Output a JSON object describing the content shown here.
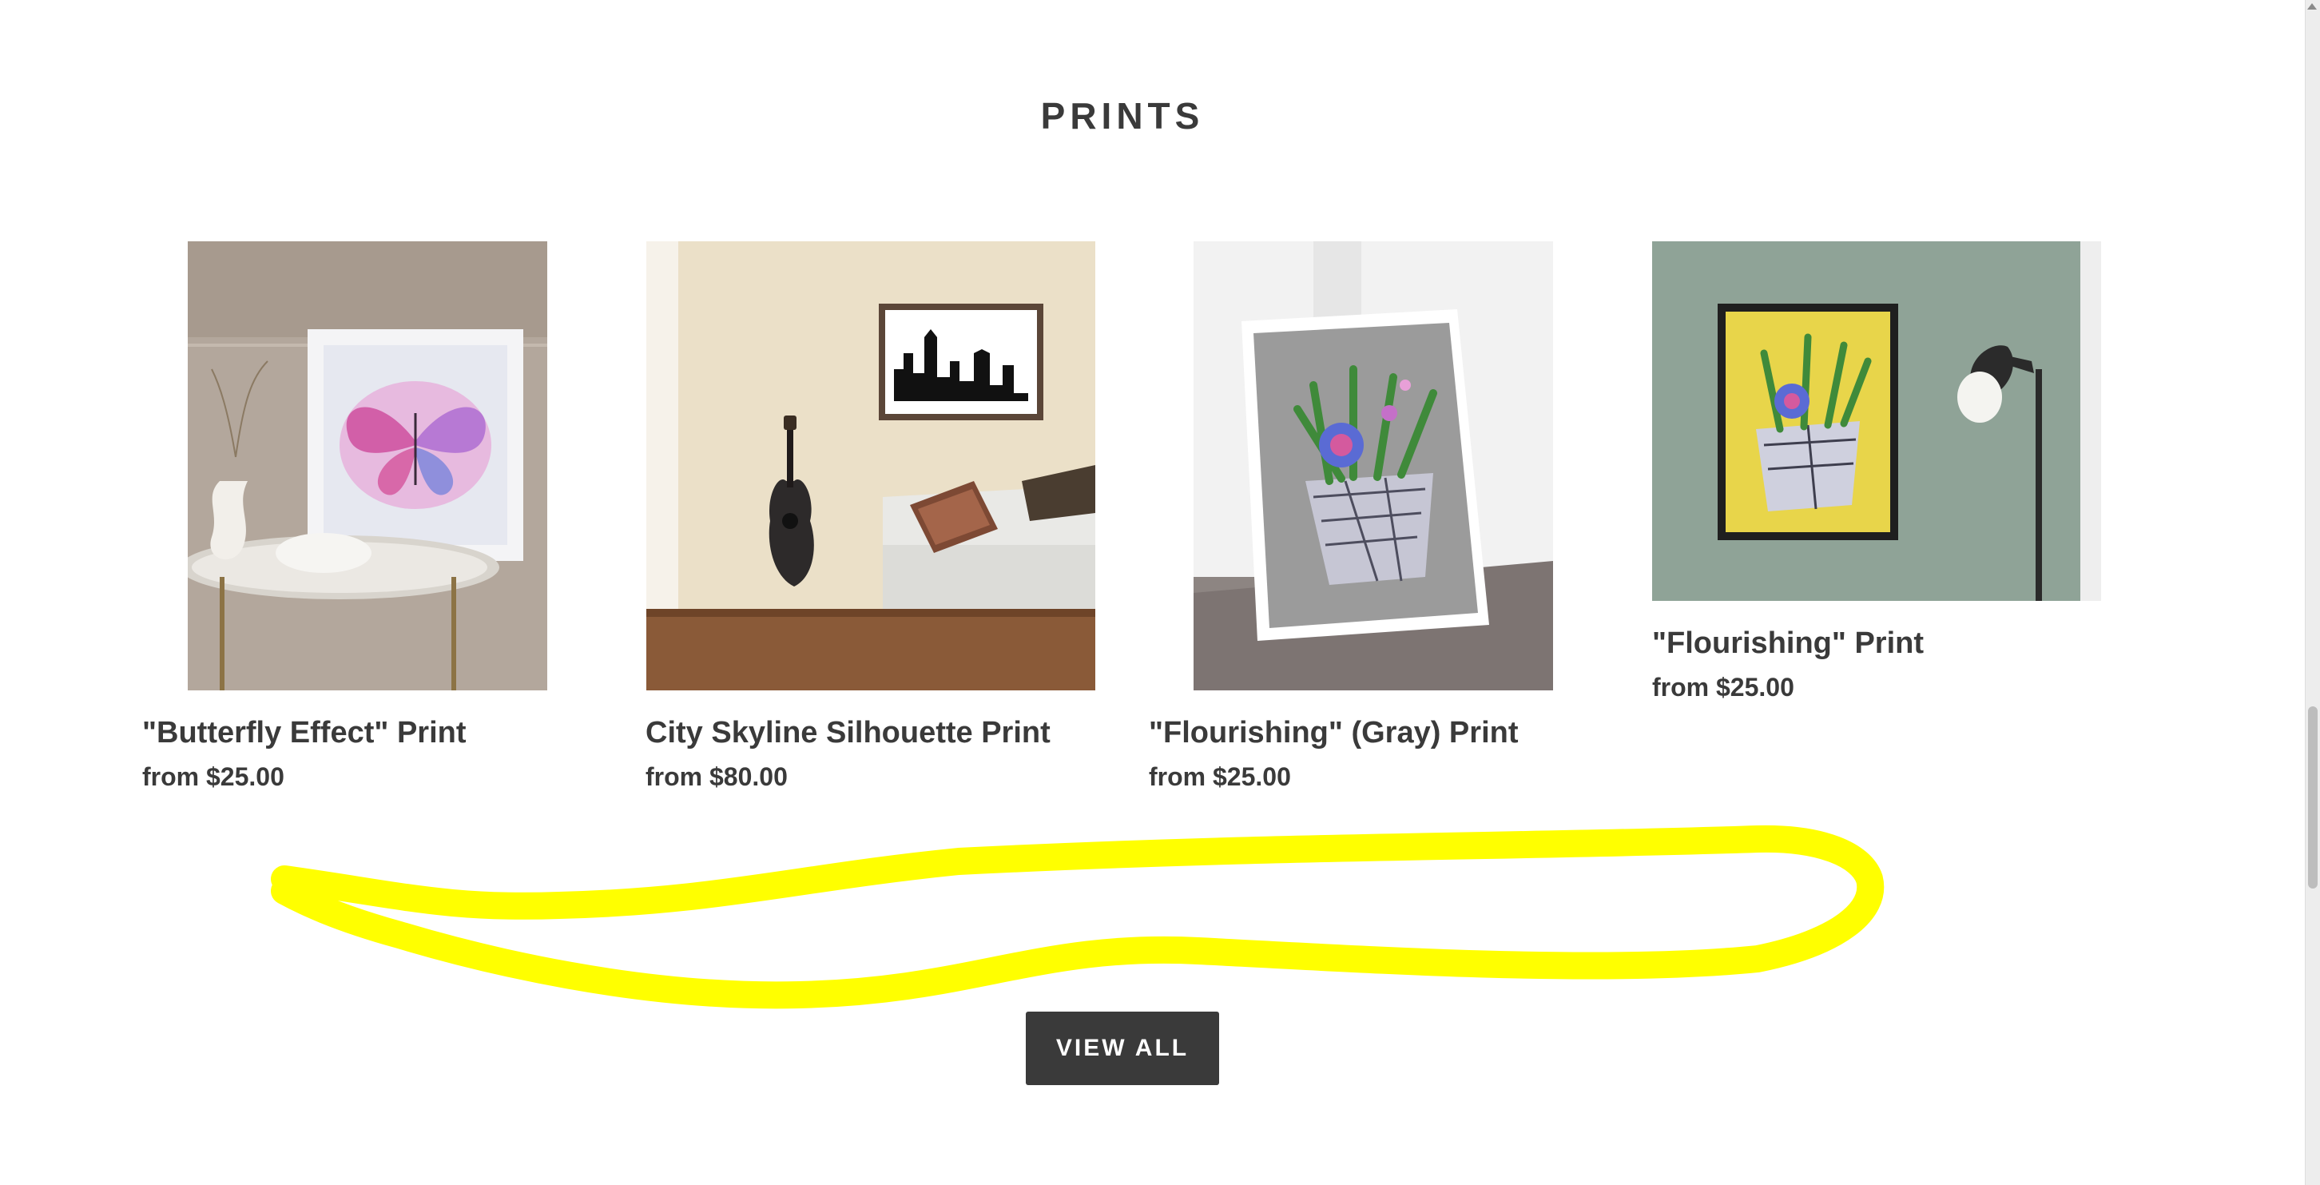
{
  "section": {
    "title": "PRINTS"
  },
  "products": [
    {
      "name": "\"Butterfly Effect\" Print",
      "price": "from $25.00"
    },
    {
      "name": "City Skyline Silhouette Print",
      "price": "from $80.00"
    },
    {
      "name": "\"Flourishing\" (Gray) Print",
      "price": "from $25.00"
    },
    {
      "name": "\"Flourishing\" Print",
      "price": "from $25.00"
    }
  ],
  "view_all": {
    "label": "VIEW ALL"
  },
  "colors": {
    "text": "#3a3a3a",
    "button_bg": "#3a3a3a",
    "annotation": "#ffff00"
  }
}
